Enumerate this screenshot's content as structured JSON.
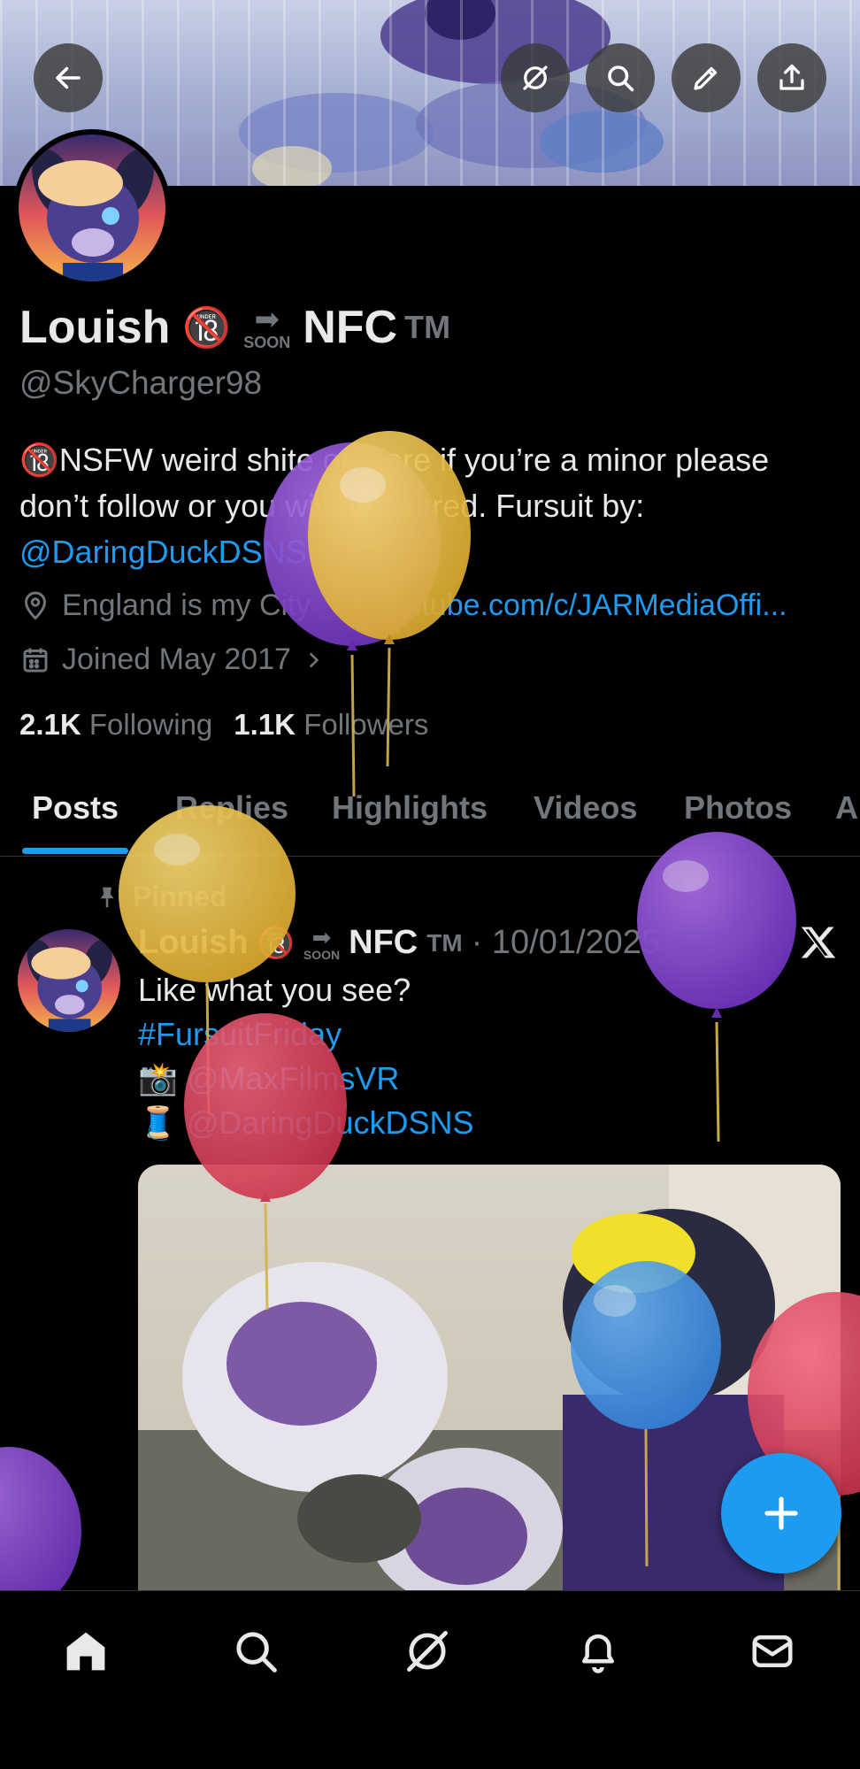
{
  "profile": {
    "name": "Louish",
    "name_emoji": "🔞",
    "soon_arrow": "➡",
    "soon_label": "SOON",
    "nfc": "NFC",
    "tm": "TM",
    "handle": "@SkyCharger98",
    "bio_emoji": "🔞",
    "bio_text": "NSFW weird shite on here if you’re a minor please don’t follow or you will be scared. Fursuit by:",
    "bio_link": "@DaringDuckDSNS",
    "location": "England is my City",
    "website": "youtube.com/c/JARMediaOffi...",
    "joined": "Joined May 2017",
    "following_count": "2.1K",
    "following_label": "Following",
    "followers_count": "1.1K",
    "followers_label": "Followers"
  },
  "top_actions": {
    "back": "back-arrow-icon",
    "grok": "grok-icon",
    "search": "search-icon",
    "edit": "edit-icon",
    "share": "share-icon"
  },
  "tabs": [
    "Posts",
    "Replies",
    "Highlights",
    "Videos",
    "Photos",
    "A"
  ],
  "post": {
    "pinned_label": "Pinned",
    "author": "Louish",
    "author_emoji": "🔞",
    "soon_label": "SOON",
    "nfc": "NFC",
    "tm": "TM",
    "date": "· 10/01/2025",
    "line1": "Like what you see?",
    "hashtag": "#FursuitFriday",
    "camera_emoji": "📸",
    "camera_credit": "@MaxFilmsVR",
    "thread_emoji": "🧵",
    "thread_credit": "@DaringDuckDSNS"
  },
  "bottom_nav": [
    "home-icon",
    "search-icon",
    "grok-icon",
    "notifications-icon",
    "messages-icon"
  ],
  "colors": {
    "accent": "#1d9bf0",
    "muted": "#71767b",
    "text": "#e7e9ea",
    "background": "#000000"
  }
}
